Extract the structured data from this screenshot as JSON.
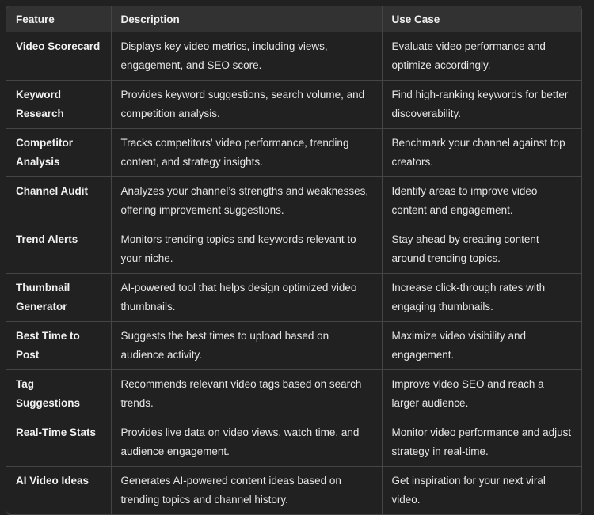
{
  "table": {
    "headers": [
      "Feature",
      "Description",
      "Use Case"
    ],
    "rows": [
      {
        "feature": "Video Scorecard",
        "description": "Displays key video metrics, including views, engagement, and SEO score.",
        "use_case": "Evaluate video performance and optimize accordingly."
      },
      {
        "feature": "Keyword Research",
        "description": "Provides keyword suggestions, search volume, and competition analysis.",
        "use_case": "Find high-ranking keywords for better discoverability."
      },
      {
        "feature": "Competitor Analysis",
        "description": "Tracks competitors' video performance, trending content, and strategy insights.",
        "use_case": "Benchmark your channel against top creators."
      },
      {
        "feature": "Channel Audit",
        "description": "Analyzes your channel’s strengths and weaknesses, offering improvement suggestions.",
        "use_case": "Identify areas to improve video content and engagement."
      },
      {
        "feature": "Trend Alerts",
        "description": "Monitors trending topics and keywords relevant to your niche.",
        "use_case": "Stay ahead by creating content around trending topics."
      },
      {
        "feature": "Thumbnail Generator",
        "description": "AI-powered tool that helps design optimized video thumbnails.",
        "use_case": "Increase click-through rates with engaging thumbnails."
      },
      {
        "feature": "Best Time to Post",
        "description": "Suggests the best times to upload based on audience activity.",
        "use_case": "Maximize video visibility and engagement."
      },
      {
        "feature": "Tag Suggestions",
        "description": "Recommends relevant video tags based on search trends.",
        "use_case": "Improve video SEO and reach a larger audience."
      },
      {
        "feature": "Real-Time Stats",
        "description": "Provides live data on video views, watch time, and audience engagement.",
        "use_case": "Monitor video performance and adjust strategy in real-time."
      },
      {
        "feature": "AI Video Ideas",
        "description": "Generates AI-powered content ideas based on trending topics and channel history.",
        "use_case": "Get inspiration for your next viral video."
      }
    ]
  },
  "colors": {
    "background": "#212121",
    "header_background": "#323232",
    "border": "#454545",
    "text": "#ececec"
  }
}
